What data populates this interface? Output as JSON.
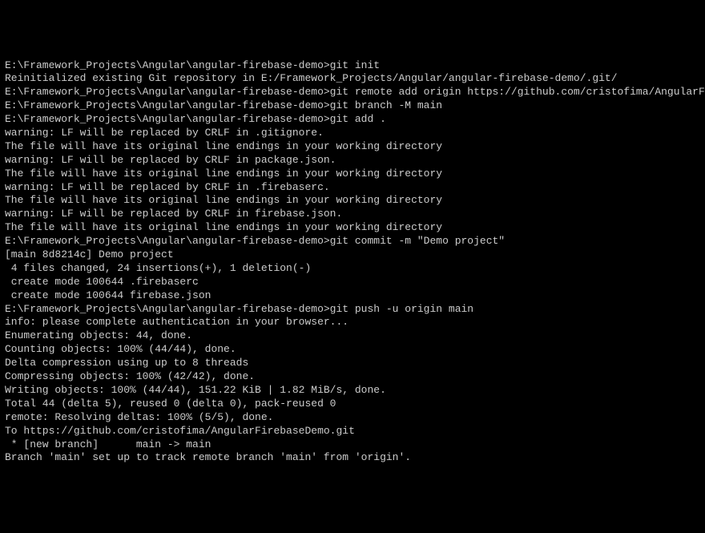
{
  "terminal": {
    "lines": [
      "E:\\Framework_Projects\\Angular\\angular-firebase-demo>git init",
      "Reinitialized existing Git repository in E:/Framework_Projects/Angular/angular-firebase-demo/.git/",
      "",
      "E:\\Framework_Projects\\Angular\\angular-firebase-demo>git remote add origin https://github.com/cristofima/AngularFirebaseDemo.git",
      "",
      "E:\\Framework_Projects\\Angular\\angular-firebase-demo>git branch -M main",
      "",
      "E:\\Framework_Projects\\Angular\\angular-firebase-demo>git add .",
      "warning: LF will be replaced by CRLF in .gitignore.",
      "The file will have its original line endings in your working directory",
      "warning: LF will be replaced by CRLF in package.json.",
      "The file will have its original line endings in your working directory",
      "warning: LF will be replaced by CRLF in .firebaserc.",
      "The file will have its original line endings in your working directory",
      "warning: LF will be replaced by CRLF in firebase.json.",
      "The file will have its original line endings in your working directory",
      "",
      "E:\\Framework_Projects\\Angular\\angular-firebase-demo>git commit -m \"Demo project\"",
      "[main 8d8214c] Demo project",
      " 4 files changed, 24 insertions(+), 1 deletion(-)",
      " create mode 100644 .firebaserc",
      " create mode 100644 firebase.json",
      "",
      "E:\\Framework_Projects\\Angular\\angular-firebase-demo>git push -u origin main",
      "info: please complete authentication in your browser...",
      "Enumerating objects: 44, done.",
      "Counting objects: 100% (44/44), done.",
      "Delta compression using up to 8 threads",
      "Compressing objects: 100% (42/42), done.",
      "Writing objects: 100% (44/44), 151.22 KiB | 1.82 MiB/s, done.",
      "Total 44 (delta 5), reused 0 (delta 0), pack-reused 0",
      "remote: Resolving deltas: 100% (5/5), done.",
      "To https://github.com/cristofima/AngularFirebaseDemo.git",
      " * [new branch]      main -> main",
      "Branch 'main' set up to track remote branch 'main' from 'origin'."
    ]
  }
}
